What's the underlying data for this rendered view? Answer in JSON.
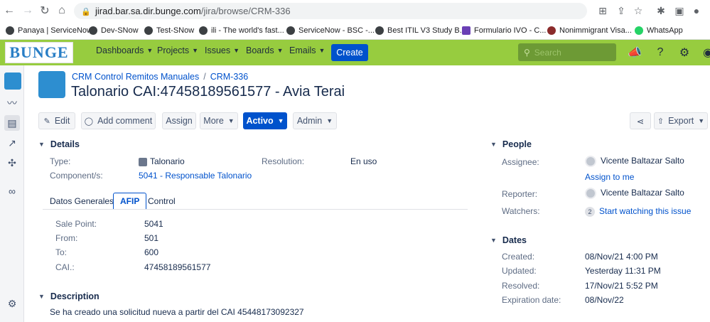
{
  "browser": {
    "url_host": "jirad.bar.sa.dir.bunge.com",
    "url_path": "/jira/browse/CRM-336",
    "bookmarks": [
      {
        "label": "Panaya | ServiceNow"
      },
      {
        "label": "Dev-SNow"
      },
      {
        "label": "Test-SNow"
      },
      {
        "label": "ili - The world's fast..."
      },
      {
        "label": "ServiceNow - BSC -..."
      },
      {
        "label": "Best ITIL V3 Study B..."
      },
      {
        "label": "Formulario IVO - C..."
      },
      {
        "label": "Nonimmigrant Visa..."
      },
      {
        "label": "WhatsApp"
      }
    ]
  },
  "header": {
    "logo": "BUNGE",
    "menu": [
      "Dashboards",
      "Projects",
      "Issues",
      "Boards",
      "Emails"
    ],
    "create": "Create",
    "search_placeholder": "Search"
  },
  "issue": {
    "project": "CRM Control Remitos Manuales",
    "key": "CRM-336",
    "summary": "Talonario CAI:47458189561577 - Avia Terai"
  },
  "toolbar": {
    "edit": "Edit",
    "add_comment": "Add comment",
    "assign": "Assign",
    "more": "More",
    "status": "Activo",
    "admin": "Admin",
    "export": "Export"
  },
  "details": {
    "heading": "Details",
    "type_label": "Type:",
    "type_value": "Talonario",
    "resolution_label": "Resolution:",
    "resolution_value": "En uso",
    "component_label": "Component/s:",
    "component_value": "5041 - Responsable Talonario"
  },
  "tabs": [
    "Datos Generales",
    "AFIP",
    "Control"
  ],
  "afip": {
    "fields": [
      {
        "label": "Sale Point:",
        "value": "5041"
      },
      {
        "label": "From:",
        "value": "501"
      },
      {
        "label": "To:",
        "value": "600"
      },
      {
        "label": "CAI.:",
        "value": "47458189561577"
      }
    ]
  },
  "description": {
    "heading": "Description",
    "text": "Se ha creado una solicitud nueva a partir del CAI 45448173092327"
  },
  "people": {
    "heading": "People",
    "assignee_label": "Assignee:",
    "assignee": "Vicente Baltazar Salto",
    "assign_to_me": "Assign to me",
    "reporter_label": "Reporter:",
    "reporter": "Vicente Baltazar Salto",
    "watchers_label": "Watchers:",
    "watchers_count": "2",
    "watch_link": "Start watching this issue"
  },
  "dates": {
    "heading": "Dates",
    "rows": [
      {
        "label": "Created:",
        "value": "08/Nov/21 4:00 PM"
      },
      {
        "label": "Updated:",
        "value": "Yesterday 11:31 PM"
      },
      {
        "label": "Resolved:",
        "value": "17/Nov/21 5:52 PM"
      },
      {
        "label": "Expiration date:",
        "value": "08/Nov/22"
      }
    ]
  }
}
